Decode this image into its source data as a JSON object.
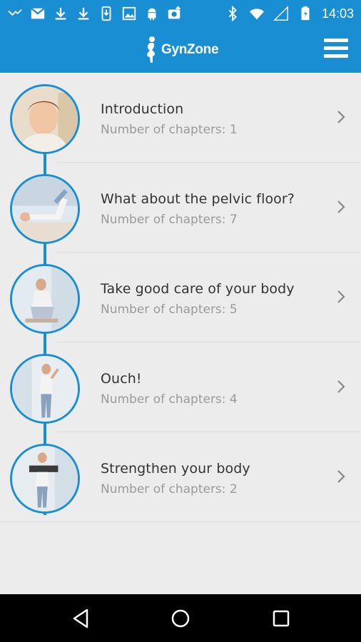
{
  "status_bar": {
    "time": "14:03",
    "left_icons": [
      "missed-call-icon",
      "gmail-icon",
      "download-icon",
      "download-icon",
      "phone-download-icon",
      "image-icon",
      "android-icon",
      "photo-upload-icon"
    ],
    "right_icons": [
      "bluetooth-icon",
      "wifi-icon",
      "cell-signal-icon",
      "battery-icon"
    ]
  },
  "app_bar": {
    "logo_text": "GynZone",
    "menu_icon": "hamburger-menu-icon",
    "accent": "#1a8ed3"
  },
  "chapters": [
    {
      "title": "Introduction",
      "subtitle": "Number of chapters: 1"
    },
    {
      "title": "What about the pelvic floor?",
      "subtitle": "Number of chapters: 7"
    },
    {
      "title": "Take good care of your body",
      "subtitle": "Number of chapters: 5"
    },
    {
      "title": "Ouch!",
      "subtitle": "Number of chapters: 4"
    },
    {
      "title": "Strengthen your body",
      "subtitle": "Number of chapters: 2"
    }
  ],
  "nav_bar": {
    "back_icon": "back-triangle-icon",
    "home_icon": "home-circle-icon",
    "recents_icon": "recents-square-icon"
  }
}
